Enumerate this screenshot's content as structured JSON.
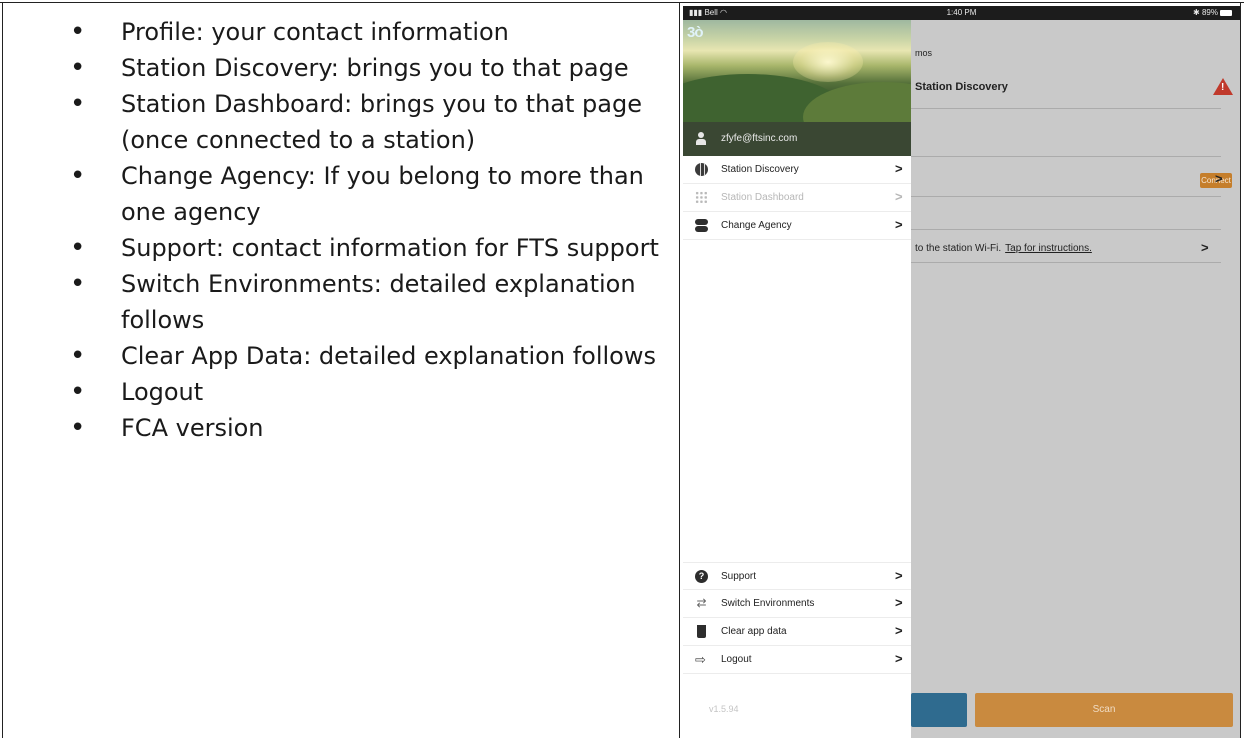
{
  "document": {
    "bullets": [
      "Profile:  your contact information",
      "Station Discovery: brings you to that page",
      "Station Dashboard:  brings you to that page (once connected to a station)",
      "Change Agency:  If you belong to more than one agency",
      "Support:  contact information for FTS support",
      "Switch Environments:  detailed explanation follows",
      "Clear App Data: detailed explanation follows",
      "Logout",
      "FCA version"
    ]
  },
  "phone": {
    "status_bar": {
      "carrier": "Bell",
      "time": "1:40 PM",
      "battery": "89%"
    },
    "drawer": {
      "logo": "3ò",
      "user_email": "zfyfe@ftsinc.com",
      "top_items": [
        {
          "label": "Station Discovery",
          "icon": "globe-icon",
          "enabled": true
        },
        {
          "label": "Station Dashboard",
          "icon": "grid-icon",
          "enabled": false
        },
        {
          "label": "Change Agency",
          "icon": "toggle-icon",
          "enabled": true
        }
      ],
      "bottom_items": [
        {
          "label": "Support",
          "icon": "question-icon"
        },
        {
          "label": "Switch Environments",
          "icon": "switch-arrows-icon"
        },
        {
          "label": "Clear app data",
          "icon": "trash-icon"
        },
        {
          "label": "Logout",
          "icon": "logout-icon"
        }
      ],
      "chevron": ">",
      "version": "v1.5.94"
    },
    "background_screen": {
      "app_name_fragment": "mos",
      "title": "Station Discovery",
      "connect_label": "Connect",
      "wifi_text": "to the station Wi-Fi.",
      "wifi_link": "Tap for instructions.",
      "scan_label": "Scan"
    },
    "colors": {
      "warning": "#c0392b",
      "connect_badge": "#c57e2b",
      "scan_button": "#c98a3f",
      "blue_button": "#2f6b8f",
      "user_row": "#3a4733"
    }
  }
}
